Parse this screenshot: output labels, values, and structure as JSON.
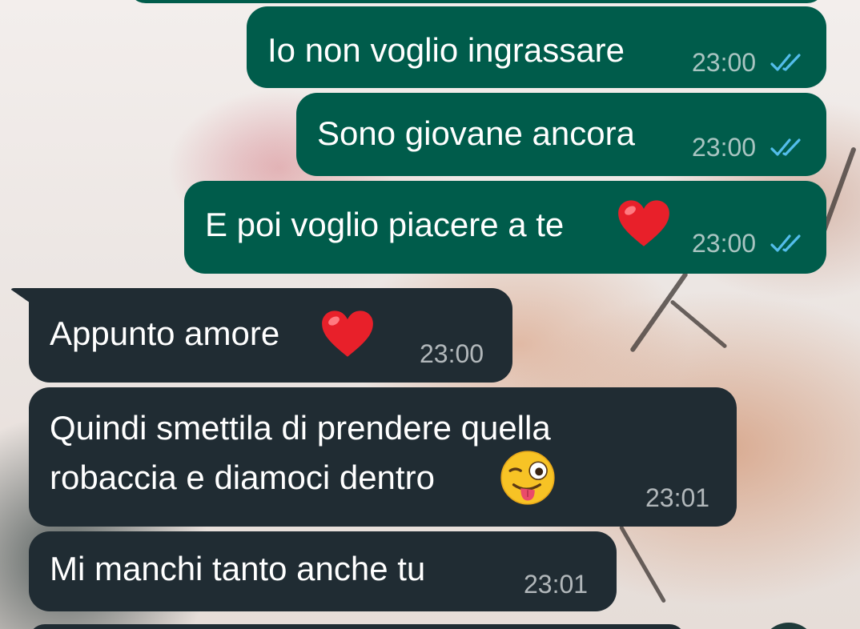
{
  "chat": {
    "messages": [
      {
        "id": "m1",
        "direction": "outgoing",
        "text": "Io non voglio ingrassare",
        "time": "23:00",
        "status": "read"
      },
      {
        "id": "m2",
        "direction": "outgoing",
        "text": "Sono giovane ancora",
        "time": "23:00",
        "status": "read"
      },
      {
        "id": "m3",
        "direction": "outgoing",
        "text": "E poi voglio piacere a te",
        "emoji": "red-heart",
        "time": "23:00",
        "status": "read"
      },
      {
        "id": "m4",
        "direction": "incoming",
        "text": "Appunto amore",
        "emoji": "red-heart",
        "time": "23:00"
      },
      {
        "id": "m5",
        "direction": "incoming",
        "line1": "Quindi smettila di prendere quella",
        "line2": "robaccia e diamoci dentro",
        "emoji": "winking-face-with-tongue",
        "time": "23:01"
      },
      {
        "id": "m6",
        "direction": "incoming",
        "text": "Mi manchi tanto anche tu",
        "time": "23:01"
      }
    ]
  },
  "colors": {
    "outgoing_bubble": "#005c4b",
    "incoming_bubble": "#202c33",
    "read_ticks": "#53bdeb",
    "message_text": "#ffffff",
    "timestamp_text": "#c4cbcd"
  }
}
